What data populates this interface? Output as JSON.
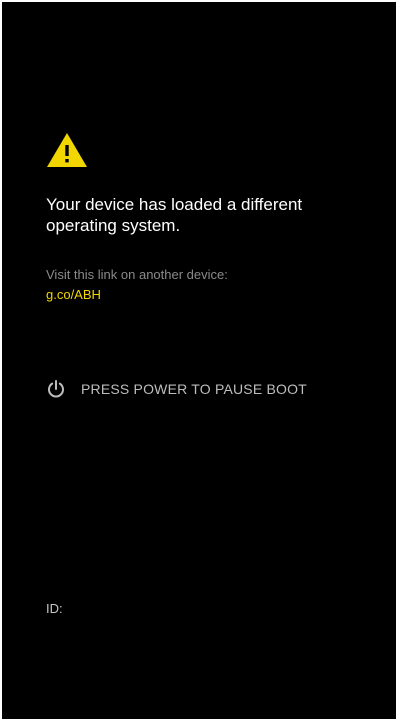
{
  "screen": {
    "background": "#000000",
    "warning_icon": "warning-triangle-icon",
    "warning_color": "#f2d600",
    "message": "Your device has loaded a different operating system.",
    "visit_text": "Visit this link on another device:",
    "link_text": "g.co/ABH",
    "link_color": "#f2d600",
    "power_icon": "power-icon",
    "power_label": "PRESS POWER TO PAUSE BOOT",
    "id_label": "ID:"
  }
}
